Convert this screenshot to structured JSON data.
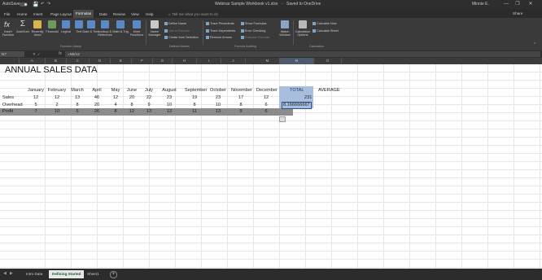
{
  "title_bar": {
    "autosave_label": "AutoSave",
    "document_title": "Webinar Sample Workbook v1.xlsx",
    "saved_status": "Saved to OneDrive",
    "user": "Minnie E."
  },
  "tabs": [
    "File",
    "Home",
    "Insert",
    "Page Layout",
    "Formulas",
    "Data",
    "Review",
    "View",
    "Help"
  ],
  "active_tab": "Formulas",
  "tell_me": "Tell me what you want to do",
  "share_label": "Share",
  "ribbon": {
    "function_library": {
      "group_label": "Function Library",
      "buttons": [
        "Insert Function",
        "AutoSum",
        "Recently Used",
        "Financial",
        "Logical",
        "Text",
        "Date & Time",
        "Lookup & Reference",
        "Math & Trig",
        "More Functions"
      ]
    },
    "defined_names": {
      "group_label": "Defined Names",
      "name_manager": "Name Manager",
      "items": [
        "Define Name",
        "Use in Formula",
        "Create from Selection"
      ]
    },
    "formula_auditing": {
      "group_label": "Formula Auditing",
      "items_left": [
        "Trace Precedents",
        "Trace Dependents",
        "Remove Arrows"
      ],
      "items_right": [
        "Show Formulas",
        "Error Checking",
        "Evaluate Formula"
      ],
      "watch_window": "Watch Window"
    },
    "calculation": {
      "group_label": "Calculation",
      "options": "Calculation Options",
      "items": [
        "Calculate Now",
        "Calculate Sheet"
      ]
    }
  },
  "formula_bar": {
    "name_box": "N7",
    "fx": "fx",
    "content": "=N5/12"
  },
  "columns": [
    "A",
    "B",
    "C",
    "D",
    "E",
    "F",
    "G",
    "H",
    "I",
    "J",
    "K",
    "L",
    "M",
    "N",
    "O"
  ],
  "sheet": {
    "title": "ANNUAL SALES DATA",
    "months": [
      "January",
      "February",
      "March",
      "April",
      "May",
      "June",
      "July",
      "August",
      "September",
      "October",
      "November",
      "December"
    ],
    "total_header": "TOTAL",
    "average_header": "AVERAGE",
    "rows": [
      {
        "label": "Sales",
        "values": [
          "12",
          "12",
          "13",
          "46",
          "12",
          "20",
          "22",
          "23",
          "19",
          "23",
          "17",
          "12"
        ],
        "total": "231",
        "average": ""
      },
      {
        "label": "Overhead",
        "values": [
          "5",
          "2",
          "8",
          "20",
          "4",
          "8",
          "9",
          "10",
          "8",
          "10",
          "8",
          "6"
        ],
        "total": "8.166666667",
        "average": ""
      },
      {
        "label": "Profit",
        "values": [
          "7",
          "10",
          "5",
          "26",
          "8",
          "12",
          "13",
          "13",
          "11",
          "13",
          "9",
          "6"
        ],
        "total": "",
        "average": ""
      }
    ]
  },
  "sheet_tabs": [
    "Intro Data",
    "Defining Started",
    "Sheet1"
  ],
  "active_sheet": "Defining Started",
  "colors": {
    "title_bar": "#2e2e2e",
    "ribbon": "#3a3a3a",
    "selection": "#a9bedc",
    "profit_row": "#8c8c8c",
    "active_sheet_text": "#1e5b2f"
  }
}
